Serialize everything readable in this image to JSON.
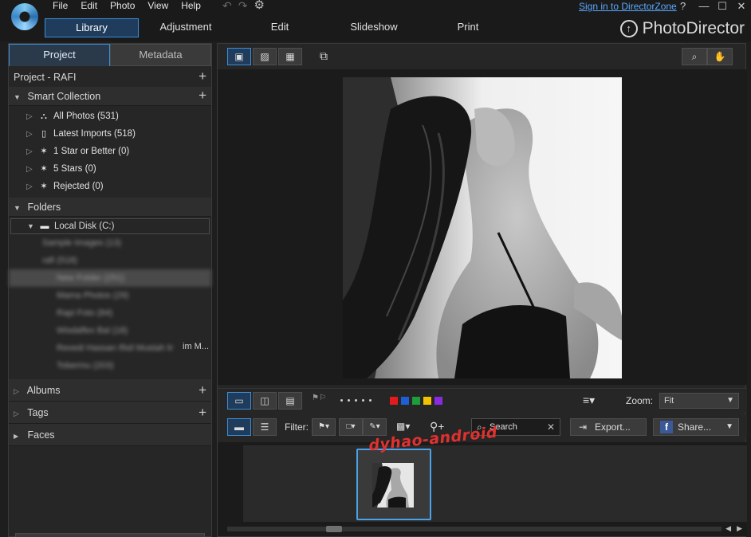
{
  "menu": [
    "File",
    "Edit",
    "Photo",
    "View",
    "Help"
  ],
  "topright": {
    "link": "Sign in to DirectorZone",
    "help": "?",
    "minimize": "—",
    "maximize": "☐",
    "close": "✕"
  },
  "modes": [
    {
      "label": "Library",
      "active": true
    },
    {
      "label": "Adjustment",
      "active": false
    },
    {
      "label": "Edit",
      "active": false
    },
    {
      "label": "Slideshow",
      "active": false
    },
    {
      "label": "Print",
      "active": false
    }
  ],
  "brand": "PhotoDirector",
  "left_tabs": {
    "project": "Project",
    "metadata": "Metadata"
  },
  "project_title": "Project - RAFI",
  "smart_collection": {
    "title": "Smart Collection",
    "items": [
      "All Photos (531)",
      "Latest Imports (518)",
      "1 Star or Better (0)",
      "5 Stars (0)",
      "Rejected (0)"
    ]
  },
  "folders": {
    "title": "Folders",
    "disk": "Local Disk (C:)",
    "blurred": [
      "Sample Images (13)",
      "rafi (518)",
      "New Folder (251)",
      "Mama Photos (29)",
      "Rapi Foto (84)",
      "Wisdaflex Bal (18)",
      "Revedi Hassan Ifisil Mustah Mom",
      "Tobermu (203)"
    ],
    "visible_tail": "im M..."
  },
  "albums": "Albums",
  "tags": "Tags",
  "faces": "Faces",
  "toolbar": {
    "zoom_label": "Zoom:",
    "zoom_value": "Fit",
    "filter_label": "Filter:",
    "search_label": "Search",
    "export_label": "Export...",
    "share_label": "Share..."
  },
  "colors": {
    "accent": "#3b8fd8",
    "label_red": "#e41a1c",
    "label_blue": "#1f5fd6",
    "label_green": "#1d9e3a",
    "label_yellow": "#f2c200",
    "label_purple": "#8a2be2",
    "watermark": "#e0312f"
  },
  "watermark": "dyhao-android"
}
